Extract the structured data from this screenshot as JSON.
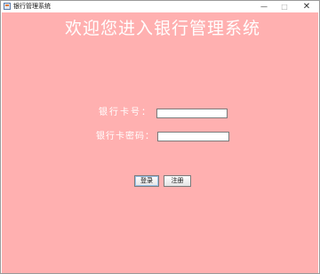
{
  "window": {
    "title": "银行管理系统",
    "controls": {
      "minimize": "—",
      "maximize": "□",
      "close": "✕"
    }
  },
  "main": {
    "heading": "欢迎您进入银行管理系统",
    "card_label": "银行卡号：",
    "password_label": "银行卡密码：",
    "card_value": "",
    "password_value": "",
    "login_label": "登录",
    "register_label": "注册"
  },
  "colors": {
    "background": "#ffb0b0",
    "heading": "#ffffff"
  },
  "icons": {
    "app": "app-window-icon"
  }
}
